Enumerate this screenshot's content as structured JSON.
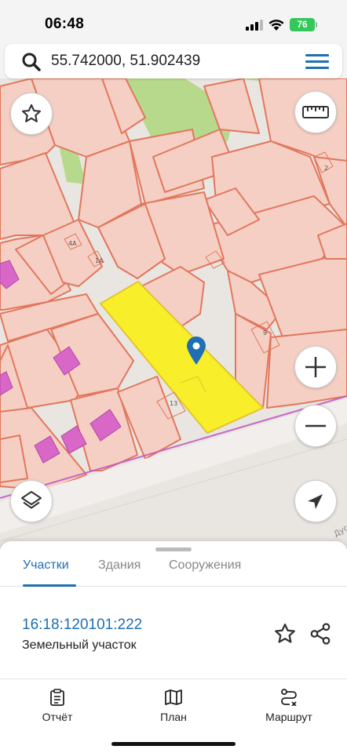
{
  "status_bar": {
    "time": "06:48",
    "battery": "76"
  },
  "search": {
    "query": "55.742000, 51.902439"
  },
  "map": {
    "house_numbers": [
      "4А",
      "1А",
      "2",
      "9",
      "13"
    ],
    "street_fragment": "Дус",
    "colors": {
      "parcel_fill": "#f5cfc4",
      "parcel_border": "#e2775d",
      "selected_parcel": "#f8ee2a",
      "building": "#d867c8",
      "green_area": "#b7d98c",
      "marker": "#1f6fb3"
    }
  },
  "sheet": {
    "tabs": [
      "Участки",
      "Здания",
      "Сооружения"
    ],
    "active_tab": "Участки",
    "parcel": {
      "cadastral_number": "16:18:120101:222",
      "type": "Земельный участок"
    }
  },
  "nav": {
    "items": [
      {
        "label": "Отчёт",
        "icon": "report-icon"
      },
      {
        "label": "План",
        "icon": "map-plan-icon"
      },
      {
        "label": "Маршрут",
        "icon": "route-icon"
      }
    ]
  }
}
